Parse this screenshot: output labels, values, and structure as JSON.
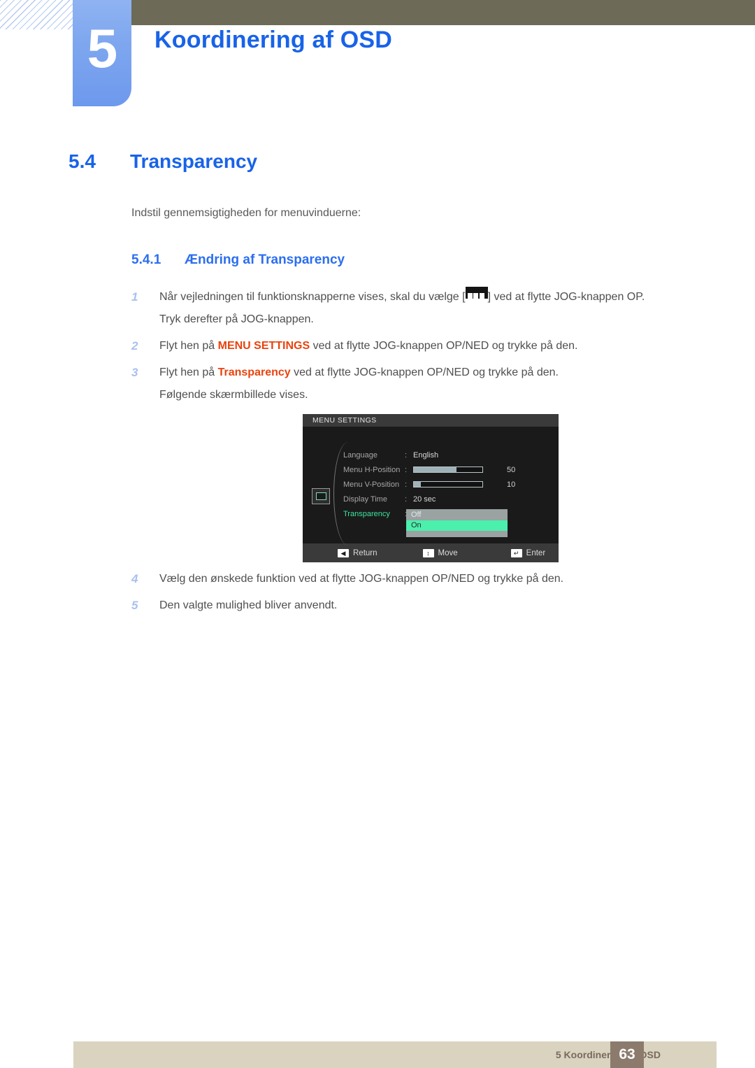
{
  "header": {
    "chapter_number": "5",
    "chapter_title": "Koordinering af OSD",
    "accent_blue": "#1863e8",
    "badge_blue": "#7fa7ef",
    "olive": "#6d6b57"
  },
  "section": {
    "number": "5.4",
    "title": "Transparency",
    "intro": "Indstil gennemsigtigheden for menuvinduerne:",
    "sub_number": "5.4.1",
    "sub_title": "Ændring af Transparency"
  },
  "steps": [
    {
      "marker": "1",
      "text_before": "Når vejledningen til funktionsknapperne vises, skal du vælge [",
      "icon": "menu-bars-icon",
      "text_after": "] ved at flytte JOG-knappen OP.",
      "continuation": "Tryk derefter på JOG-knappen."
    },
    {
      "marker": "2",
      "text_before": "Flyt hen på ",
      "keyword": "MENU SETTINGS",
      "text_after": " ved at flytte JOG-knappen OP/NED og trykke på den.",
      "continuation": ""
    },
    {
      "marker": "3",
      "text_before": "Flyt hen på ",
      "keyword": "Transparency",
      "text_after": " ved at flytte JOG-knappen OP/NED og trykke på den.",
      "continuation": "Følgende skærmbillede vises."
    },
    {
      "marker": "4",
      "text_before": "Vælg den ønskede funktion ved at flytte JOG-knappen OP/NED og trykke på den.",
      "keyword": "",
      "text_after": "",
      "continuation": ""
    },
    {
      "marker": "5",
      "text_before": "Den valgte mulighed bliver anvendt.",
      "keyword": "",
      "text_after": "",
      "continuation": ""
    }
  ],
  "keyword_color": "#e8430f",
  "osd": {
    "title": "MENU SETTINGS",
    "rows": [
      {
        "label": "Language",
        "colon": ":",
        "type": "text",
        "value": "English"
      },
      {
        "label": "Menu H-Position",
        "colon": ":",
        "type": "slider",
        "value": "50",
        "fill_percent": 62
      },
      {
        "label": "Menu V-Position",
        "colon": ":",
        "type": "slider",
        "value": "10",
        "fill_percent": 10
      },
      {
        "label": "Display Time",
        "colon": ":",
        "type": "text",
        "value": "20 sec"
      },
      {
        "label": "Transparency",
        "colon": ":",
        "type": "dropdown",
        "value": ""
      }
    ],
    "dropdown_options": [
      {
        "label": "Off",
        "selected": false
      },
      {
        "label": "On",
        "selected": true
      }
    ],
    "side_icon": "display-settings-icon",
    "footer_buttons": [
      {
        "key": "◀",
        "label": "Return"
      },
      {
        "key": "↕",
        "label": "Move"
      },
      {
        "key": "↵",
        "label": "Enter"
      }
    ],
    "highlight_green": "#4bf0ac",
    "active_label_green": "#3ae6a0"
  },
  "footer": {
    "text": "5 Koordinering af OSD",
    "page_number": "63",
    "bar_color": "#d9d3c0",
    "page_box_color": "#8c7b6d"
  }
}
